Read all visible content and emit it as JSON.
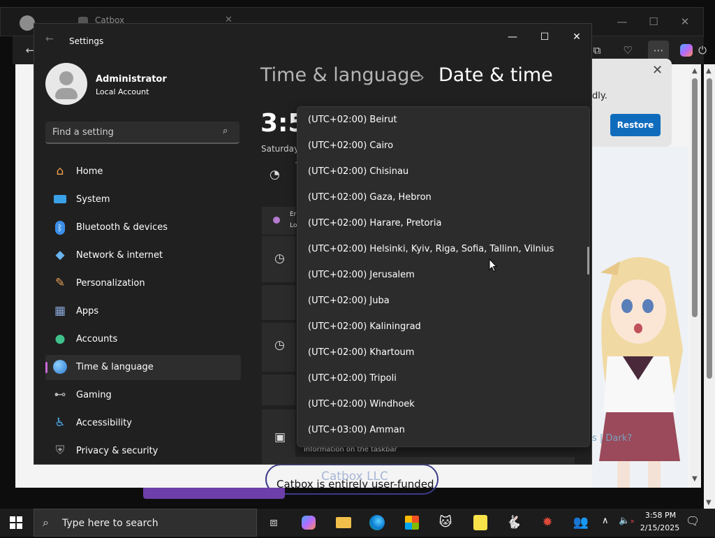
{
  "browser": {
    "tab_title": "Catbox",
    "toolbar_icons": [
      "back-icon",
      "extensions-icon",
      "health-icon",
      "more-icon",
      "copilot-icon",
      "power-icon"
    ],
    "restore_message": "dly.",
    "restore_button": "Restore",
    "page_link_text": "s | Dark?",
    "catbox_heading": "Catbox LLC",
    "catbox_tagline": "Catbox is entirely user-funded"
  },
  "settings": {
    "title": "Settings",
    "user": {
      "name": "Administrator",
      "account_type": "Local Account"
    },
    "search_placeholder": "Find a setting",
    "nav": [
      {
        "label": "Home",
        "icon": "home-icon",
        "color": "#f3a14b"
      },
      {
        "label": "System",
        "icon": "system-icon",
        "color": "#3aa0e8"
      },
      {
        "label": "Bluetooth & devices",
        "icon": "bluetooth-icon",
        "color": "#3a8ee8"
      },
      {
        "label": "Network & internet",
        "icon": "wifi-icon",
        "color": "#6ab4f0"
      },
      {
        "label": "Personalization",
        "icon": "brush-icon",
        "color": "#e8a05a"
      },
      {
        "label": "Apps",
        "icon": "apps-icon",
        "color": "#8aa8d8"
      },
      {
        "label": "Accounts",
        "icon": "accounts-icon",
        "color": "#3ec18a"
      },
      {
        "label": "Time & language",
        "icon": "time-language-icon",
        "color": "#4aa8e8",
        "active": true
      },
      {
        "label": "Gaming",
        "icon": "gaming-icon",
        "color": "#b8b8b8"
      },
      {
        "label": "Accessibility",
        "icon": "accessibility-icon",
        "color": "#4aa8e8"
      },
      {
        "label": "Privacy & security",
        "icon": "shield-icon",
        "color": "#9a9a9a"
      }
    ],
    "breadcrumb": {
      "parent": "Time & language",
      "current": "Date & time"
    },
    "clock": "3:5",
    "clock_date_fragment": "Saturday",
    "taskbar_info": "information on the taskbar",
    "card_fragments": {
      "row1_line1": "Er",
      "row1_line2": "Lo",
      "row3_time": "T"
    },
    "timezone_options": [
      "(UTC+02:00) Beirut",
      "(UTC+02:00) Cairo",
      "(UTC+02:00) Chisinau",
      "(UTC+02:00) Gaza, Hebron",
      "(UTC+02:00) Harare, Pretoria",
      "(UTC+02:00) Helsinki, Kyiv, Riga, Sofia, Tallinn, Vilnius",
      "(UTC+02:00) Jerusalem",
      "(UTC+02:00) Juba",
      "(UTC+02:00) Kaliningrad",
      "(UTC+02:00) Khartoum",
      "(UTC+02:00) Tripoli",
      "(UTC+02:00) Windhoek",
      "(UTC+03:00) Amman"
    ]
  },
  "taskbar": {
    "search_placeholder": "Type here to search",
    "apps": [
      "task-view-icon",
      "copilot-icon",
      "file-explorer-icon",
      "edge-icon",
      "store-icon",
      "cat-app-icon",
      "spongebob-icon",
      "rabbit-app-icon",
      "crab-app-icon",
      "people-app-icon"
    ],
    "time": "3:58 PM",
    "date": "2/15/2025"
  }
}
